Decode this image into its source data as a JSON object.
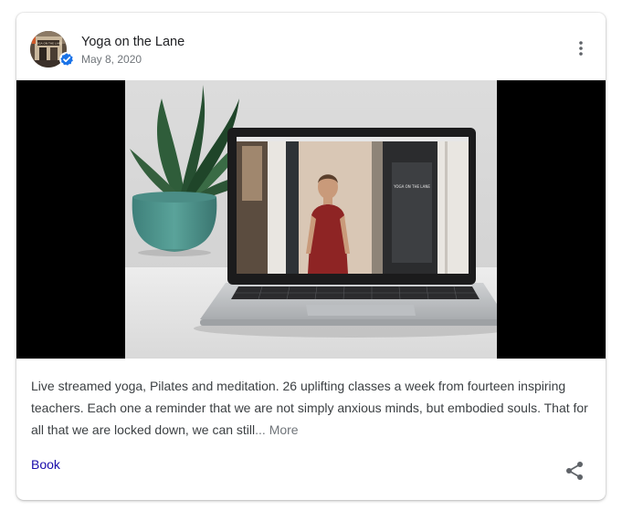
{
  "post": {
    "business_name": "Yoga on the Lane",
    "date": "May 8, 2020",
    "verified": true,
    "body": "Live streamed yoga, Pilates and meditation. 26 uplifting classes a week from fourteen inspiring teachers. Each one a reminder that we are not simply anxious minds, but embodied souls. That for all that we are locked down, we can still",
    "ellipsis": "...",
    "more_label": "More",
    "book_label": "Book",
    "avatar_sign_text": "YOGA ON THE LANE",
    "screen_sign_text": "YOGA ON THE LANE"
  },
  "icons": {
    "menu": "more-vert-icon",
    "share": "share-icon",
    "verified": "verified-check-icon"
  },
  "colors": {
    "link": "#1a0dab",
    "verified_badge": "#1a73e8",
    "muted": "#70757a"
  }
}
